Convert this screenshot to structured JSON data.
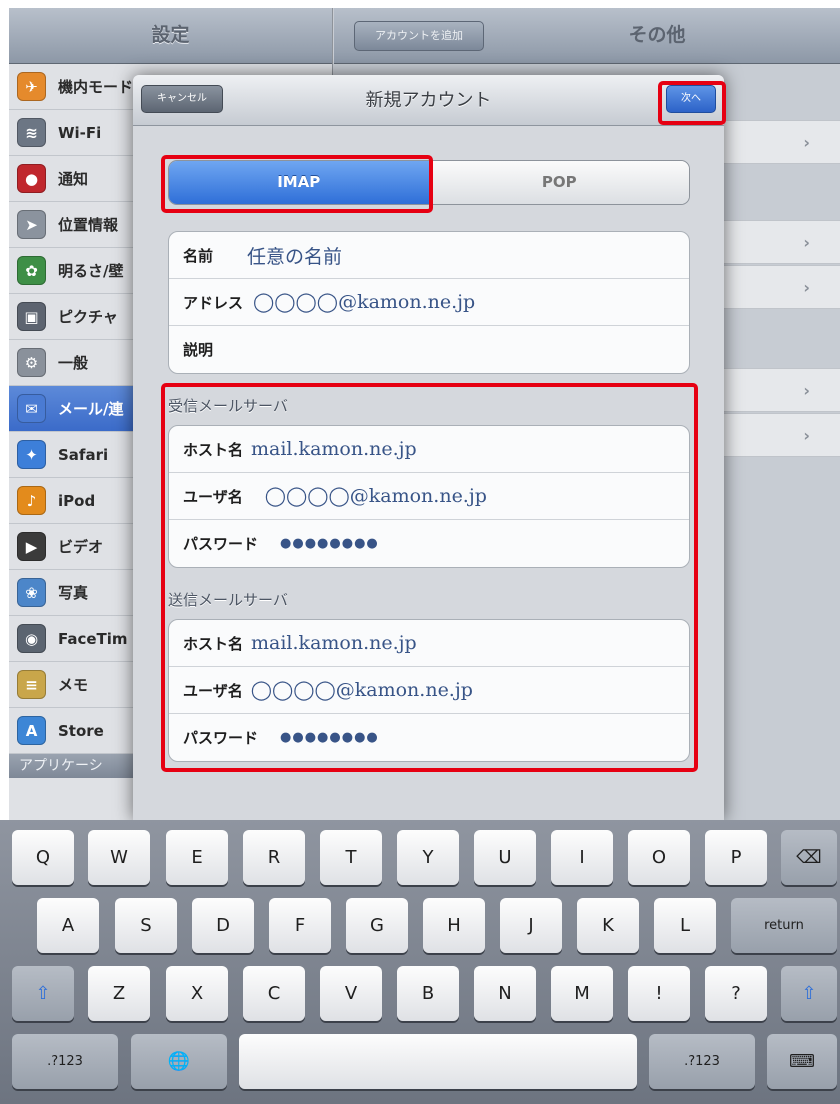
{
  "background": {
    "left_title": "設定",
    "right_back": "アカウントを追加",
    "right_title": "その他",
    "sidebar": [
      {
        "label": "機内モード",
        "icon": "airplane-icon",
        "color": "#e58a2c"
      },
      {
        "label": "Wi-Fi",
        "icon": "wifi-icon",
        "color": "#6c7684"
      },
      {
        "label": "通知",
        "icon": "notification-icon",
        "color": "#c0272d"
      },
      {
        "label": "位置情報",
        "icon": "location-icon",
        "color": "#8b939e"
      },
      {
        "label": "明るさ/壁",
        "icon": "brightness-icon",
        "color": "#3e8f46"
      },
      {
        "label": "ピクチャ",
        "icon": "picture-frame-icon",
        "color": "#5d6470"
      },
      {
        "label": "一般",
        "icon": "gear-icon",
        "color": "#8a919b"
      },
      {
        "label": "メール/連",
        "icon": "mail-icon",
        "color": "#4a7bd3"
      },
      {
        "label": "Safari",
        "icon": "compass-icon",
        "color": "#3d7fd9"
      },
      {
        "label": "iPod",
        "icon": "ipod-icon",
        "color": "#e38b1c"
      },
      {
        "label": "ビデオ",
        "icon": "video-icon",
        "color": "#3b3b3b"
      },
      {
        "label": "写真",
        "icon": "sunflower-icon",
        "color": "#4c86c9"
      },
      {
        "label": "FaceTim",
        "icon": "facetime-icon",
        "color": "#5b6470"
      },
      {
        "label": "メモ",
        "icon": "notes-icon",
        "color": "#c9a64a"
      },
      {
        "label": "Store",
        "icon": "app-store-icon",
        "color": "#3d86d6"
      }
    ],
    "sidebar_section": "アプリケーシ"
  },
  "sheet": {
    "cancel": "キャンセル",
    "title": "新規アカウント",
    "next": "次へ",
    "segments": [
      "IMAP",
      "POP"
    ],
    "account": [
      {
        "label": "名前",
        "value": "任意の名前"
      },
      {
        "label": "アドレス",
        "value": "◯◯◯◯@kamon.ne.jp"
      },
      {
        "label": "説明",
        "value": ""
      }
    ],
    "incoming_header": "受信メールサーバ",
    "incoming": [
      {
        "label": "ホスト名",
        "value": "mail.kamon.ne.jp"
      },
      {
        "label": "ユーザ名",
        "value": "◯◯◯◯@kamon.ne.jp"
      },
      {
        "label": "パスワード",
        "value": "●●●●●●●●"
      }
    ],
    "outgoing_header": "送信メールサーバ",
    "outgoing": [
      {
        "label": "ホスト名",
        "value": "mail.kamon.ne.jp"
      },
      {
        "label": "ユーザ名",
        "value": "◯◯◯◯@kamon.ne.jp"
      },
      {
        "label": "パスワード",
        "value": "●●●●●●●●"
      }
    ]
  },
  "keyboard": {
    "row1": [
      "Q",
      "W",
      "E",
      "R",
      "T",
      "Y",
      "U",
      "I",
      "O",
      "P"
    ],
    "row2": [
      "A",
      "S",
      "D",
      "F",
      "G",
      "H",
      "J",
      "K",
      "L"
    ],
    "row3": [
      "Z",
      "X",
      "C",
      "V",
      "B",
      "N",
      "M"
    ],
    "backspace": "⌫",
    "return": "return",
    "shift": "⇧",
    "exclaim": "!",
    "question": "?",
    "numbers": ".?123",
    "globe": "🌐",
    "hide": "⌨",
    "highlight_color": "#e60012"
  }
}
